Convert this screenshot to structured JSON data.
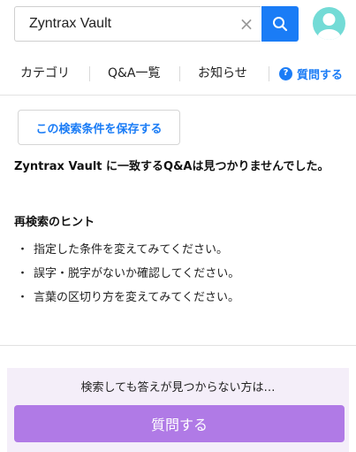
{
  "search": {
    "value": "Zyntrax Vault",
    "clear_icon": "close-icon",
    "button_icon": "search-icon",
    "accent_color": "#1a7cf6"
  },
  "user": {
    "avatar_icon": "user-avatar-icon",
    "avatar_color": "#73dbd6"
  },
  "nav": {
    "items": [
      {
        "label": "カテゴリ"
      },
      {
        "label": "Q&A一覧"
      },
      {
        "label": "お知らせ"
      }
    ],
    "ask": {
      "label": "質問する",
      "icon": "question-circle-icon"
    }
  },
  "main": {
    "save_search_label": "この検索条件を保存する",
    "no_result_message": "Zyntrax Vault に一致するQ&Aは見つかりませんでした。",
    "hint_title": "再検索のヒント",
    "hints": [
      "指定した条件を変えてみてください。",
      "誤字・脱字がないか確認してください。",
      "言葉の区切り方を変えてみてください。"
    ],
    "bullet": "・"
  },
  "cta": {
    "text": "検索しても答えが見つからない方は…",
    "button_label": "質問する",
    "panel_color": "#f4eef9",
    "button_color": "#b07ae6"
  }
}
